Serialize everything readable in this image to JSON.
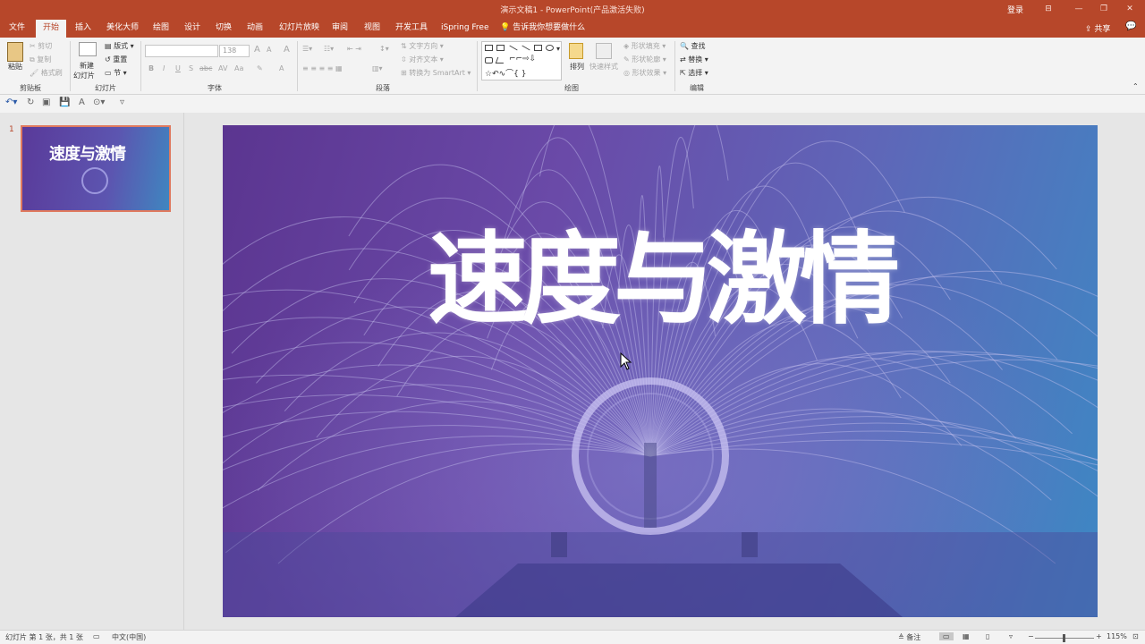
{
  "window": {
    "title": "演示文稿1  -  PowerPoint(产品激活失败)",
    "login": "登录",
    "controls": [
      "⊟",
      "—",
      "❐",
      "✕"
    ]
  },
  "tabs": [
    "文件",
    "开始",
    "插入",
    "美化大师",
    "绘图",
    "设计",
    "切换",
    "动画",
    "幻灯片放映",
    "审阅",
    "视图",
    "开发工具",
    "iSpring Free"
  ],
  "tell_me": "告诉我你想要做什么",
  "share": "共享",
  "ribbon": {
    "clipboard": {
      "paste": "粘贴",
      "cut": "剪切",
      "copy": "复制",
      "format_painter": "格式刷",
      "label": "剪贴板"
    },
    "slides": {
      "new_slide": "新建",
      "new_slide_2": "幻灯片",
      "layout": "版式",
      "reset": "重置",
      "section": "节",
      "label": "幻灯片"
    },
    "font": {
      "font_size": "138",
      "label": "字体",
      "bold": "B",
      "italic": "I",
      "underline": "U",
      "strike": "S",
      "abc": "abc",
      "spacing": "AV",
      "case": "Aa",
      "grow": "A",
      "shrink": "A",
      "clear": "A",
      "color": "A"
    },
    "paragraph": {
      "text_direction": "文字方向",
      "align_text": "对齐文本",
      "smartart": "转换为 SmartArt",
      "label": "段落"
    },
    "drawing": {
      "arrange": "排列",
      "quick_styles": "快速样式",
      "shape_fill": "形状填充",
      "shape_outline": "形状轮廓",
      "shape_effects": "形状效果",
      "label": "绘图"
    },
    "editing": {
      "find": "查找",
      "replace": "替换",
      "select": "选择",
      "label": "编辑"
    }
  },
  "thumbnails": [
    {
      "number": "1",
      "title": "速度与激情"
    }
  ],
  "slide": {
    "title": "速度与激情"
  },
  "status": {
    "slide_info": "幻灯片 第 1 张，共 1 张",
    "language": "中文(中国)",
    "notes": "备注",
    "zoom": "115%"
  },
  "colors": {
    "accent": "#b7472a",
    "slide_gradient_start": "#5b3590",
    "slide_gradient_end": "#3d88c4"
  }
}
